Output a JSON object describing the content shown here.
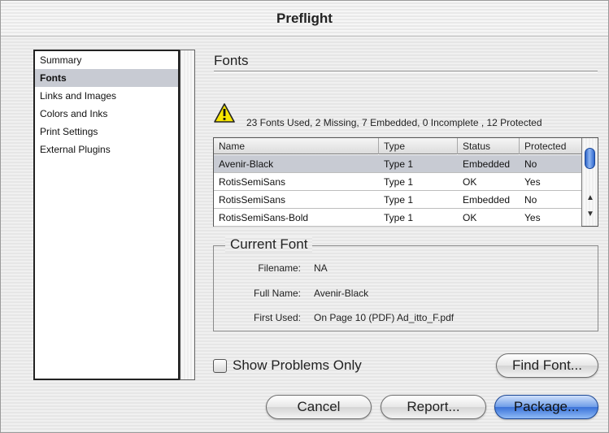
{
  "window": {
    "title": "Preflight"
  },
  "sidebar": {
    "items": [
      {
        "label": "Summary",
        "selected": false
      },
      {
        "label": "Fonts",
        "selected": true
      },
      {
        "label": "Links and Images",
        "selected": false
      },
      {
        "label": "Colors and Inks",
        "selected": false
      },
      {
        "label": "Print Settings",
        "selected": false
      },
      {
        "label": "External Plugins",
        "selected": false
      }
    ]
  },
  "panel": {
    "title": "Fonts",
    "summary": "23 Fonts Used, 2 Missing, 7 Embedded, 0 Incomplete , 12 Protected",
    "warning_icon": "warning-triangle-icon"
  },
  "font_table": {
    "columns": [
      "Name",
      "Type",
      "Status",
      "Protected"
    ],
    "rows": [
      {
        "name": "Avenir-Black",
        "type": "Type 1",
        "status": "Embedded",
        "protected": "No",
        "selected": true
      },
      {
        "name": "RotisSemiSans",
        "type": "Type 1",
        "status": "OK",
        "protected": "Yes",
        "selected": false
      },
      {
        "name": "RotisSemiSans",
        "type": "Type 1",
        "status": "Embedded",
        "protected": "No",
        "selected": false
      },
      {
        "name": "RotisSemiSans-Bold",
        "type": "Type 1",
        "status": "OK",
        "protected": "Yes",
        "selected": false
      }
    ]
  },
  "current_font": {
    "legend": "Current Font",
    "filename_label": "Filename:",
    "filename_value": "NA",
    "fullname_label": "Full Name:",
    "fullname_value": "Avenir-Black",
    "firstused_label": "First Used:",
    "firstused_value": "On Page 10 (PDF) Ad_itto_F.pdf"
  },
  "options": {
    "show_problems_label": "Show Problems Only",
    "show_problems_checked": false
  },
  "buttons": {
    "find_font": "Find Font...",
    "cancel": "Cancel",
    "report": "Report...",
    "package": "Package..."
  },
  "colors": {
    "selection": "#c8cbd3",
    "accent": "#3a72d8"
  }
}
